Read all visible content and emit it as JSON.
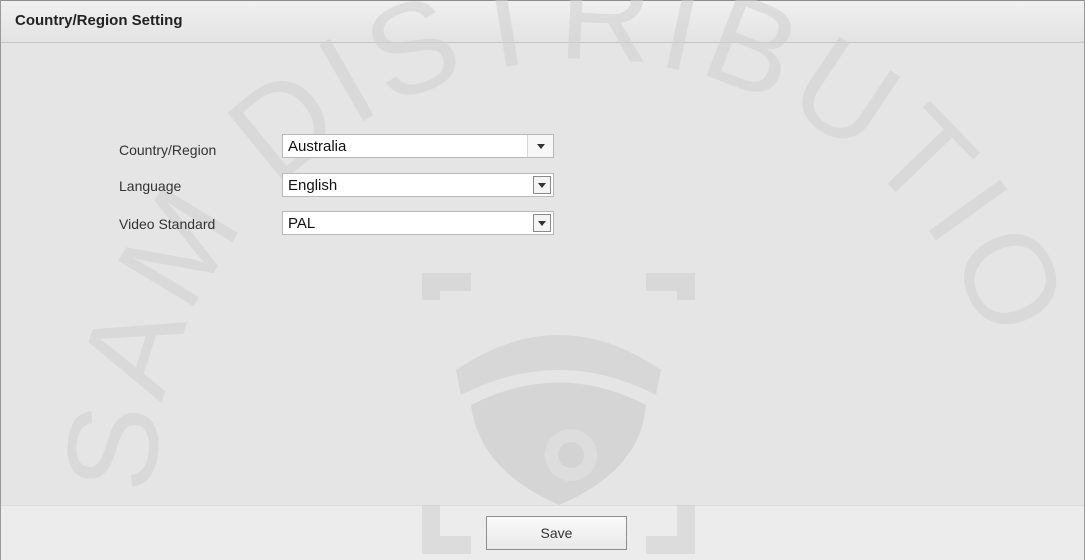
{
  "header": {
    "title": "Country/Region Setting"
  },
  "form": {
    "country_region": {
      "label": "Country/Region",
      "value": "Australia"
    },
    "language": {
      "label": "Language",
      "value": "English"
    },
    "video_standard": {
      "label": "Video Standard",
      "value": "PAL"
    }
  },
  "footer": {
    "save_label": "Save"
  },
  "watermark": {
    "text": "SAM DISTRIBUTION",
    "icon": "dome-camera-icon"
  },
  "colors": {
    "panel_bg": "#e7e7e7",
    "header_bg": "#e9e9e9",
    "field_bg": "#ffffff"
  }
}
